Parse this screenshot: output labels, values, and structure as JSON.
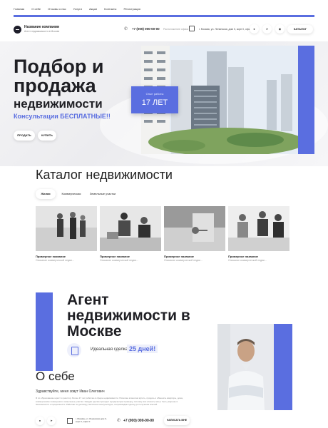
{
  "nav": {
    "items": [
      "Главная",
      "О себе",
      "Отзывы о нас",
      "Услуги",
      "Акции",
      "Контакты",
      "Регистрация"
    ]
  },
  "header": {
    "brand_name": "Название компании",
    "brand_sub": "Агент недвижимости в Москве",
    "phone": "+7 (000) 000-00-00",
    "office_label": "Расположение офиса",
    "address": "г. Москва, ул. Ленинская, дом 0, корп 0, офис 0",
    "social": [
      "vk",
      "tg",
      "wa"
    ],
    "catalog_btn": "КАТАЛОГ"
  },
  "hero": {
    "title_line1": "Подбор и",
    "title_line2": "продажа",
    "title_line3": "недвижимости",
    "subtitle": "Консультации БЕСПЛАТНЫЕ!!",
    "btn_sell": "ПРОДАТЬ",
    "btn_buy": "КУПИТЬ",
    "badge_label": "Опыт работы",
    "badge_value": "17 ЛЕТ"
  },
  "catalog": {
    "title": "Каталог недвижимости",
    "tabs": [
      "Жилая",
      "Коммерческая",
      "Земельные участки"
    ],
    "cards": [
      {
        "title": "Примерное название",
        "desc": "Описание коммерческой недви..."
      },
      {
        "title": "Примерное название",
        "desc": "Описание коммерческой недви..."
      },
      {
        "title": "Примерное название",
        "desc": "Описание коммерческой недви..."
      },
      {
        "title": "Примерное название",
        "desc": "Описание коммерческой недви..."
      }
    ]
  },
  "agent": {
    "title": "Агент недвижимости в Москве",
    "deal_text": "Идеальная сделка за",
    "deal_days": "25 дней!"
  },
  "about": {
    "title": "О себе",
    "greeting": "Здравствуйте, меня зовут Иван Олегович",
    "body": "Я по образованию юрист и риелтор. Более 17 лет работаю в сфере недвижимости. Помогаю клиентам купить, продать и обменять квартиры, дома, коммерческие помещения и земельные участки. Каждая сделка проходит юридическую проверку, поэтому мои клиенты могут быть уверены в безопасности и прозрачности. Работаю по договору, бесплатно консультирую, сопровождаю сделку до получения ключей.",
    "address": "г. Москва, ул. Ленинская дом 0, корп 0, офис 0",
    "phone": "+7 (000) 000-00-00",
    "write_btn": "НАПИСАТЬ МНЕ",
    "social": [
      "vk",
      "tg",
      "wa"
    ]
  },
  "colors": {
    "accent": "#5a6ee0",
    "dark": "#1f1f24"
  }
}
